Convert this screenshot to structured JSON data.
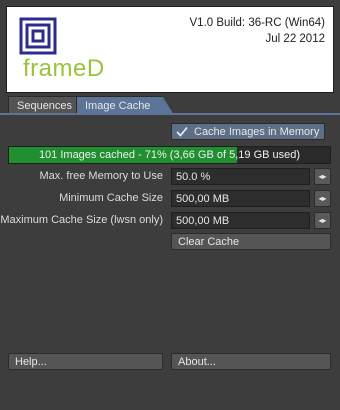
{
  "header": {
    "logo_text": "frameD",
    "version_line": "V1.0 Build: 36-RC (Win64)",
    "date_line": "Jul 22 2012"
  },
  "tabs": [
    {
      "label": "Sequences",
      "active": false
    },
    {
      "label": "Image Cache",
      "active": true
    }
  ],
  "cache": {
    "cache_checkbox_label": "Cache Images in Memory",
    "cache_checked": true,
    "progress_text": "101 Images cached - 71% (3,66 GB of 5,19 GB used)",
    "progress_fraction": 0.71,
    "fields": [
      {
        "label": "Max. free Memory to Use",
        "value": "50.0 %"
      },
      {
        "label": "Minimum Cache Size",
        "value": "500,00 MB"
      },
      {
        "label": "Maximum Cache Size (lwsn only)",
        "value": "500,00 MB"
      }
    ],
    "clear_label": "Clear Cache"
  },
  "footer": {
    "help_label": "Help...",
    "about_label": "About..."
  },
  "colors": {
    "accent": "#5b7497",
    "progress": "#1f8f2f",
    "logo_green": "#9bc23c"
  }
}
